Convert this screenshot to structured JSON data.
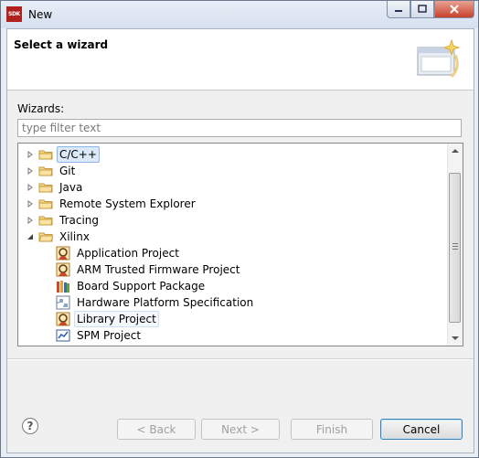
{
  "window": {
    "title": "New",
    "app_icon_text": "SDK"
  },
  "header": {
    "title": "Select a wizard"
  },
  "wizards_label": "Wizards:",
  "filter": {
    "value": "",
    "placeholder": "type filter text"
  },
  "tree": {
    "items": [
      {
        "label": "C/C++",
        "level": 0,
        "expanded": false,
        "icon": "folder-icon",
        "selected": true
      },
      {
        "label": "Git",
        "level": 0,
        "expanded": false,
        "icon": "folder-icon"
      },
      {
        "label": "Java",
        "level": 0,
        "expanded": false,
        "icon": "folder-icon"
      },
      {
        "label": "Remote System Explorer",
        "level": 0,
        "expanded": false,
        "icon": "folder-icon"
      },
      {
        "label": "Tracing",
        "level": 0,
        "expanded": false,
        "icon": "folder-icon"
      },
      {
        "label": "Xilinx",
        "level": 0,
        "expanded": true,
        "icon": "folder-icon"
      },
      {
        "label": "Application Project",
        "level": 1,
        "icon": "application-project-icon"
      },
      {
        "label": "ARM Trusted Firmware Project",
        "level": 1,
        "icon": "arm-firmware-project-icon"
      },
      {
        "label": "Board Support Package",
        "level": 1,
        "icon": "board-support-package-icon"
      },
      {
        "label": "Hardware Platform Specification",
        "level": 1,
        "icon": "hardware-platform-icon"
      },
      {
        "label": "Library Project",
        "level": 1,
        "icon": "library-project-icon",
        "hover": true
      },
      {
        "label": "SPM Project",
        "level": 1,
        "icon": "spm-project-icon"
      }
    ]
  },
  "buttons": {
    "back": "< Back",
    "next": "Next >",
    "finish": "Finish",
    "cancel": "Cancel"
  }
}
